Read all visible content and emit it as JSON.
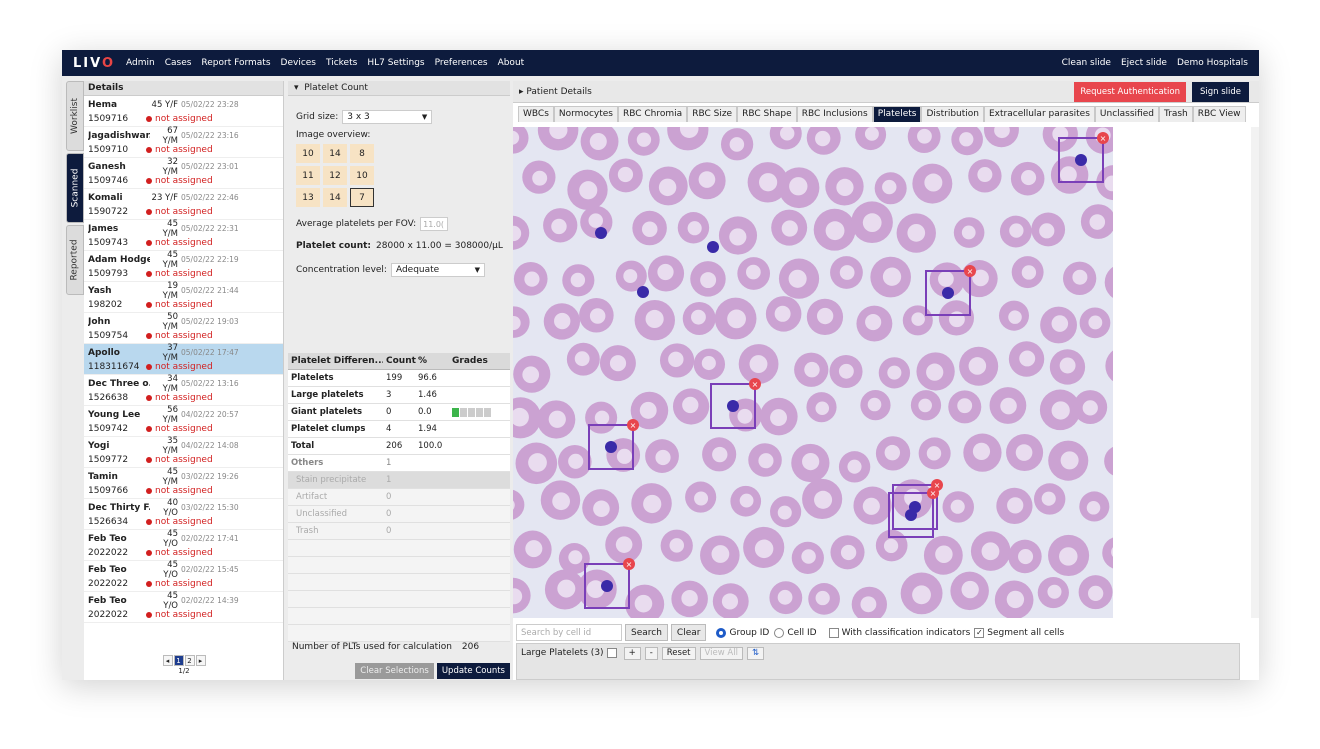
{
  "nav": {
    "logo_main": "LIV",
    "logo_accent": "O",
    "items": [
      "Admin",
      "Cases",
      "Report Formats",
      "Devices",
      "Tickets",
      "HL7 Settings",
      "Preferences",
      "About"
    ],
    "right": [
      "Clean slide",
      "Eject slide",
      "Demo Hospitals"
    ]
  },
  "sidetabs": [
    "Worklist",
    "Scanned",
    "Reported"
  ],
  "caselist": {
    "header": "Details",
    "cases": [
      {
        "name": "Hema",
        "age": "45 Y/F",
        "date": "05/02/22 23:28",
        "id": "1509716",
        "status": "not assigned"
      },
      {
        "name": "Jagadishwar...",
        "age": "67 Y/M",
        "date": "05/02/22 23:16",
        "id": "1509710",
        "status": "not assigned"
      },
      {
        "name": "Ganesh",
        "age": "32 Y/M",
        "date": "05/02/22 23:01",
        "id": "1509746",
        "status": "not assigned"
      },
      {
        "name": "Komali",
        "age": "23 Y/F",
        "date": "05/02/22 22:46",
        "id": "1590722",
        "status": "not assigned"
      },
      {
        "name": "James",
        "age": "45 Y/M",
        "date": "05/02/22 22:31",
        "id": "1509743",
        "status": "not assigned"
      },
      {
        "name": "Adam Hodge",
        "age": "45 Y/M",
        "date": "05/02/22 22:19",
        "id": "1509793",
        "status": "not assigned"
      },
      {
        "name": "Yash",
        "age": "19 Y/M",
        "date": "05/02/22 21:44",
        "id": "198202",
        "status": "not assigned"
      },
      {
        "name": "John",
        "age": "50 Y/M",
        "date": "05/02/22 19:03",
        "id": "1509754",
        "status": "not assigned"
      },
      {
        "name": "Apollo",
        "age": "37 Y/M",
        "date": "05/02/22 17:47",
        "id": "118311674",
        "status": "not assigned"
      },
      {
        "name": "Dec Three o...",
        "age": "34 Y/M",
        "date": "05/02/22 13:16",
        "id": "1526638",
        "status": "not assigned"
      },
      {
        "name": "Young Lee",
        "age": "56 Y/M",
        "date": "04/02/22 20:57",
        "id": "1509742",
        "status": "not assigned"
      },
      {
        "name": "Yogi",
        "age": "35 Y/M",
        "date": "04/02/22 14:08",
        "id": "1509772",
        "status": "not assigned"
      },
      {
        "name": "Tamin",
        "age": "45 Y/M",
        "date": "03/02/22 19:26",
        "id": "1509766",
        "status": "not assigned"
      },
      {
        "name": "Dec Thirty F...",
        "age": "40 Y/O",
        "date": "03/02/22 15:30",
        "id": "1526634",
        "status": "not assigned"
      },
      {
        "name": "Feb Teo",
        "age": "45 Y/O",
        "date": "02/02/22 17:41",
        "id": "2022022",
        "status": "not assigned"
      },
      {
        "name": "Feb Teo",
        "age": "45 Y/O",
        "date": "02/02/22 15:45",
        "id": "2022022",
        "status": "not assigned"
      },
      {
        "name": "Feb Teo",
        "age": "45 Y/O",
        "date": "02/02/22 14:39",
        "id": "2022022",
        "status": "not assigned"
      }
    ],
    "pager": {
      "prev": "◂",
      "pages": [
        "1",
        "2"
      ],
      "next": "▸",
      "info": "1/2"
    }
  },
  "platelet_count": {
    "header": "Platelet Count",
    "grid_size_label": "Grid size:",
    "grid_size_value": "3 x 3",
    "overview_label": "Image overview:",
    "grid": [
      "10",
      "14",
      "8",
      "11",
      "12",
      "10",
      "13",
      "14",
      "7"
    ],
    "avg_label": "Average platelets per FOV:",
    "avg_value": "11.0(",
    "count_label": "Platelet count:",
    "count_value": "28000  x 11.00 = 308000/µL",
    "concentration_label": "Concentration level:",
    "concentration_value": "Adequate",
    "diff_headers": [
      "Platelet Differen...",
      "Count",
      "%",
      "Grades"
    ],
    "diff_rows": [
      {
        "name": "Platelets",
        "count": "199",
        "pct": "96.6"
      },
      {
        "name": "Large platelets",
        "count": "3",
        "pct": "1.46"
      },
      {
        "name": "Giant platelets",
        "count": "0",
        "pct": "0.0"
      },
      {
        "name": "Platelet clumps",
        "count": "4",
        "pct": "1.94"
      },
      {
        "name": "Total",
        "count": "206",
        "pct": "100.0"
      }
    ],
    "giant_grade": {
      "value": "0",
      "level_fraction": 0.2
    },
    "others_row": {
      "name": "Others",
      "count": "1"
    },
    "others": [
      {
        "name": "Stain precipitate",
        "count": "1"
      },
      {
        "name": "Artifact",
        "count": "0"
      },
      {
        "name": "Unclassified",
        "count": "0"
      },
      {
        "name": "Trash",
        "count": "0"
      }
    ],
    "plts_used_label": "Number of PLTs used for calculation",
    "plts_used_value": "206",
    "clear_btn": "Clear Selections",
    "update_btn": "Update Counts"
  },
  "right": {
    "patient_details": "▸  Patient Details",
    "auth_btn": "Request Authentication",
    "sign_btn": "Sign slide",
    "tabs": [
      "WBCs",
      "Normocytes",
      "RBC Chromia",
      "RBC Size",
      "RBC Shape",
      "RBC Inclusions",
      "Platelets",
      "Distribution",
      "Extracellular parasites",
      "Unclassified",
      "Trash",
      "RBC View"
    ],
    "active_tab": "Platelets",
    "search_placeholder": "Search by cell id",
    "search_btn": "Search",
    "clear_btn": "Clear",
    "group_id": "Group ID",
    "cell_id": "Cell ID",
    "with_class": "With classification indicators",
    "segment_all": "Segment all cells",
    "large_platelets_label": "Large Platelets (3)",
    "lp_plus": "+",
    "lp_minus": "-",
    "lp_reset": "Reset",
    "lp_viewall": "View All",
    "lp_sort": "⇅"
  },
  "colors": {
    "nav_bg": "#0d1b3d",
    "accent_red": "#e8464d",
    "status_red": "#d21f1f",
    "selected_row": "#b9d8ee",
    "rbc": "#cba2d2",
    "platelet": "#3a2aa8",
    "box": "#7a3fb8"
  }
}
